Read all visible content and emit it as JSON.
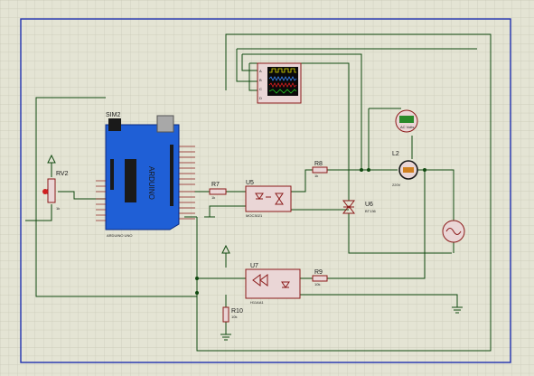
{
  "schematic": {
    "arduino": {
      "ref": "SIM2",
      "subtitle": "ARDUINO UNO",
      "brand": "ARDUINO"
    },
    "potentiometer": {
      "ref": "RV2",
      "value": "1k"
    },
    "resistors": [
      {
        "ref": "R7",
        "value": "1k"
      },
      {
        "ref": "R8",
        "value": "1k"
      },
      {
        "ref": "R9",
        "value": "10k"
      },
      {
        "ref": "R10",
        "value": "10k"
      }
    ],
    "optocoupler_triac": {
      "ref": "U5",
      "part": "MOC3021"
    },
    "optocoupler_zc": {
      "ref": "U7",
      "part": "H11AA1"
    },
    "triac": {
      "ref": "U6",
      "part": "BT136"
    },
    "lamp": {
      "ref": "L2",
      "value": "220V"
    },
    "voltmeter": {
      "label": "AC Volts"
    },
    "oscilloscope": {
      "channels": [
        "A",
        "B",
        "C",
        "D"
      ]
    }
  },
  "colors": {
    "background": "#e4e4d4",
    "grid": "#c6c6b4",
    "border": "#2030b0",
    "wire": "#104a10",
    "component": "#8b1a1a",
    "arduino_board": "#1f5fd6"
  }
}
